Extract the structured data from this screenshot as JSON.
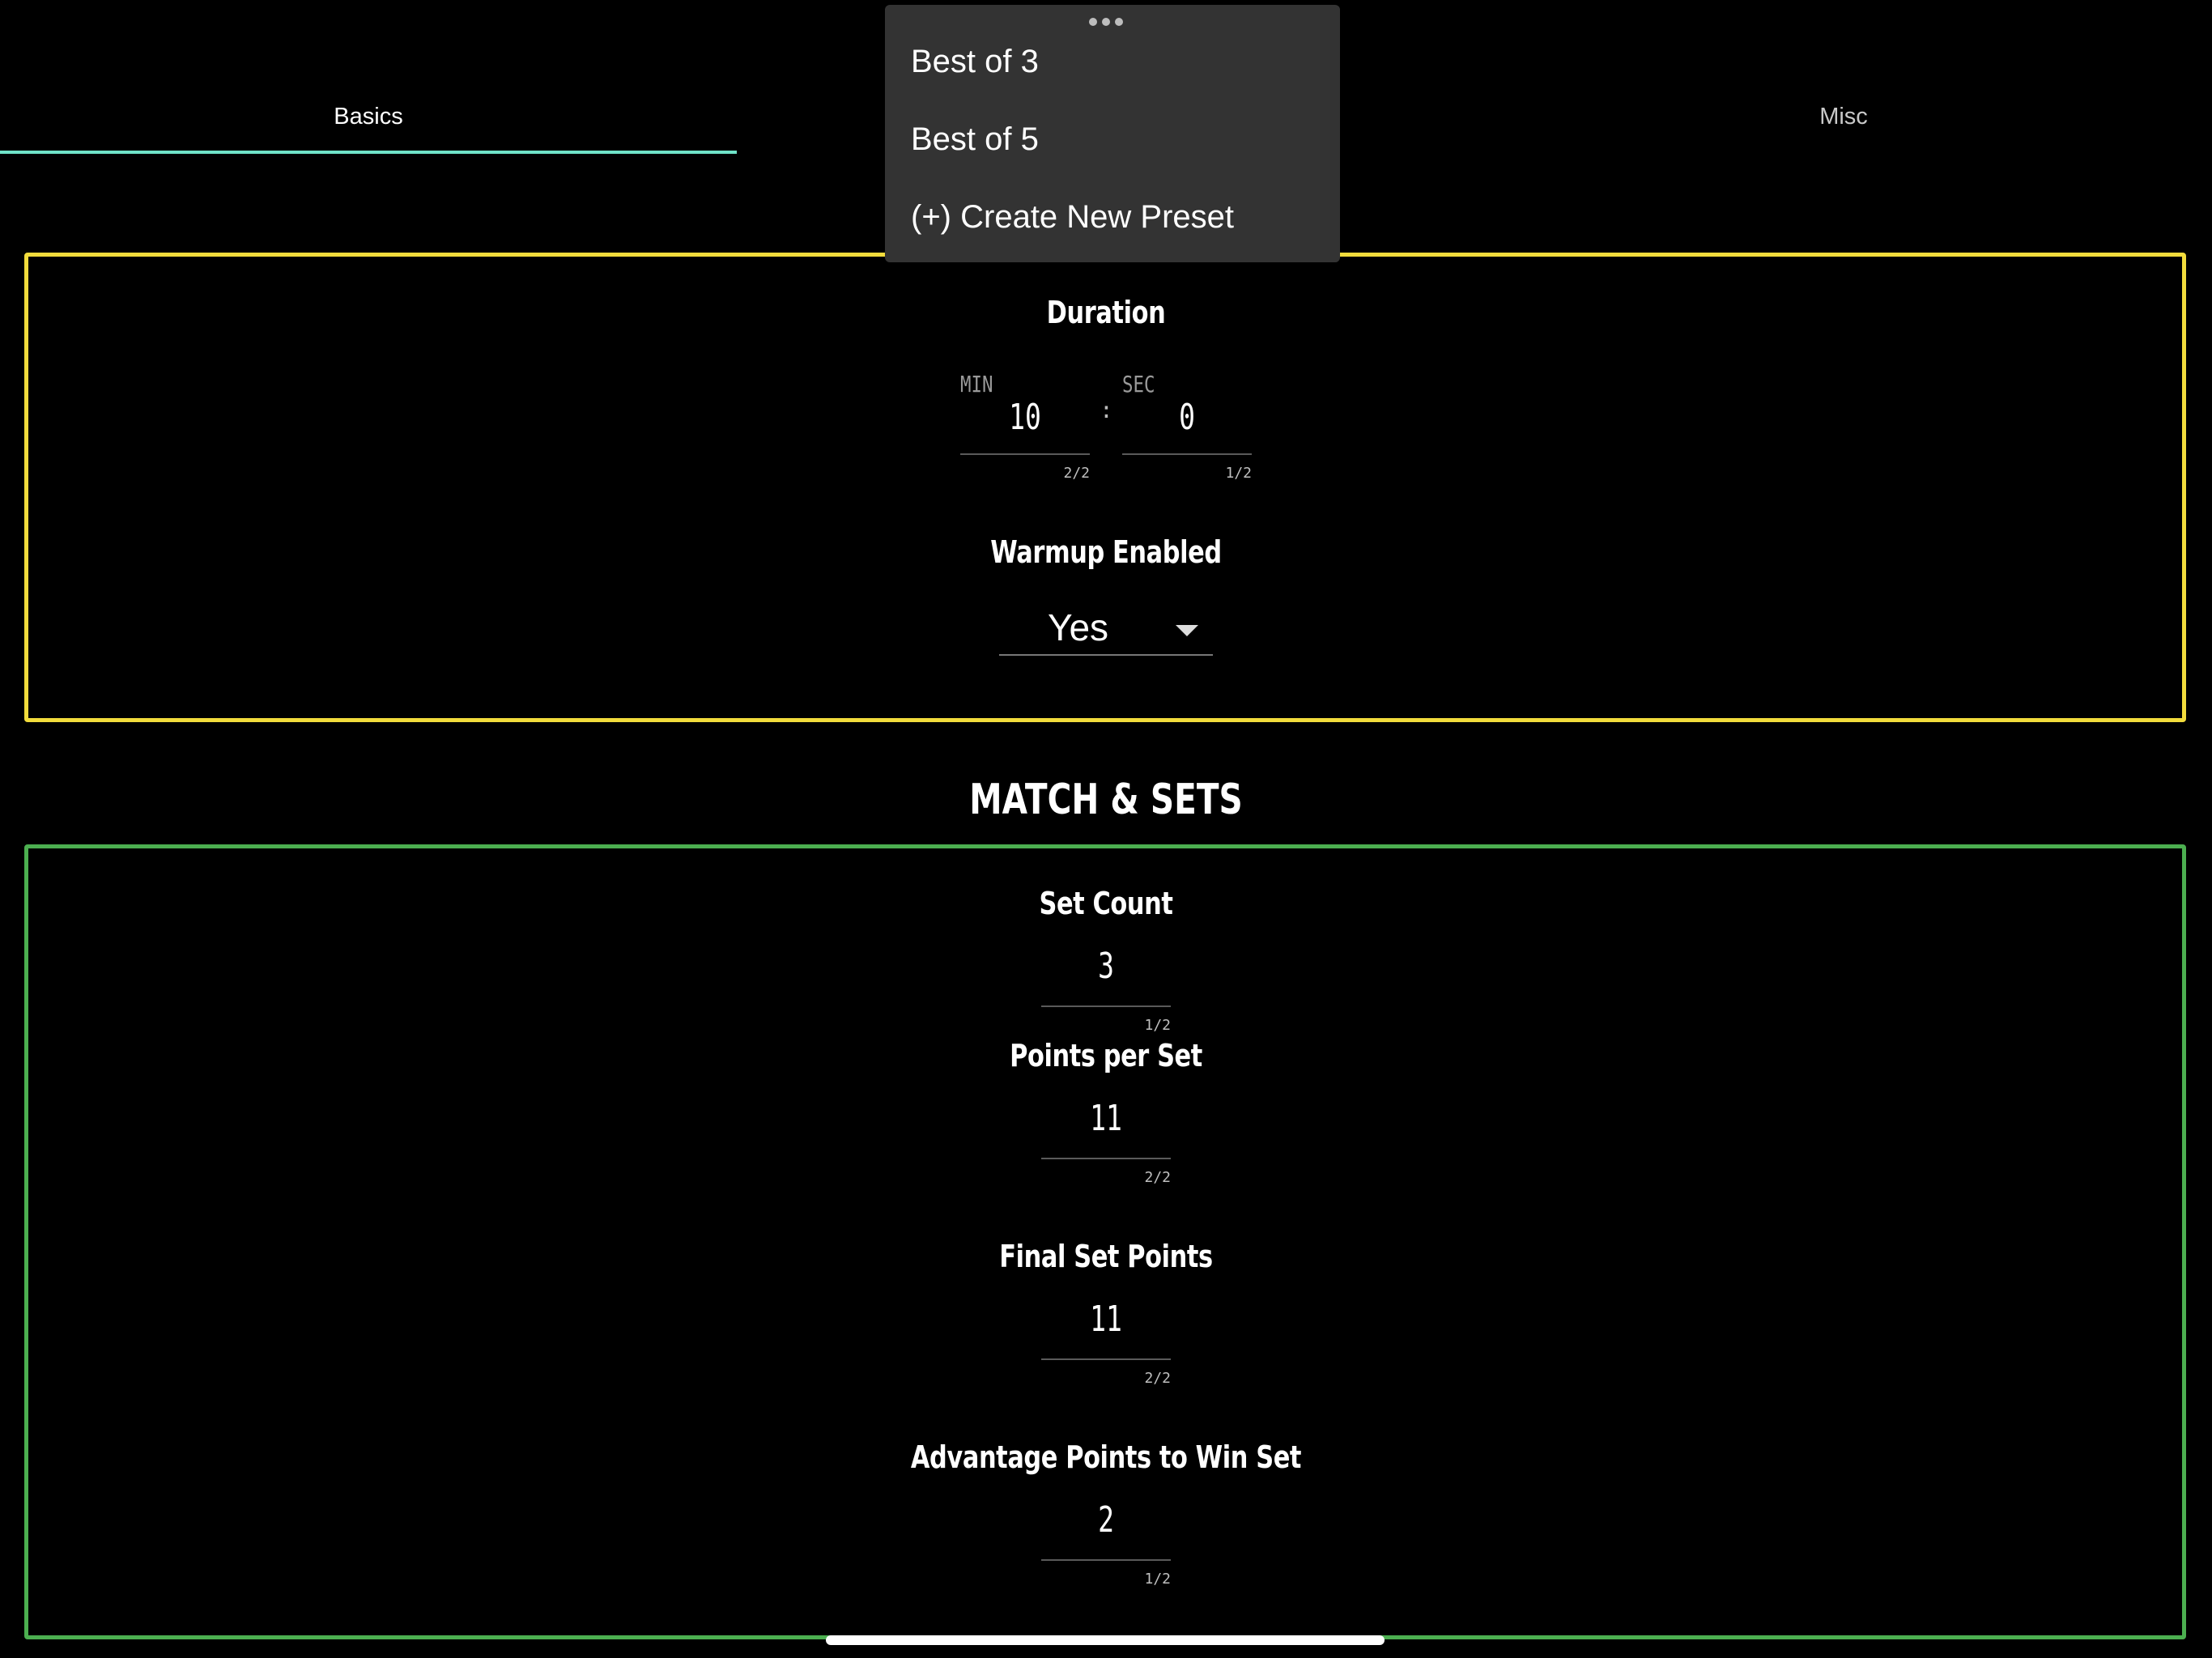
{
  "tabs": [
    {
      "label": "Basics",
      "active": true
    },
    {
      "label": "Misc",
      "active": false
    }
  ],
  "colors": {
    "accent": "#6fe3c8",
    "yellow_panel": "#f2dc3c",
    "green_panel": "#4caf50",
    "menu_bg": "#333333"
  },
  "menu": {
    "items": [
      "Best of 3",
      "Best of 5",
      "(+) Create New Preset"
    ]
  },
  "duration": {
    "title": "Duration",
    "min_label": "MIN",
    "sec_label": "SEC",
    "minutes": "10",
    "seconds": "0",
    "separator": ":",
    "min_counter": "2/2",
    "sec_counter": "1/2"
  },
  "warmup": {
    "title": "Warmup Enabled",
    "value": "Yes"
  },
  "match_sets": {
    "title": "MATCH & SETS",
    "set_count": {
      "title": "Set Count",
      "value": "3",
      "counter": "1/2"
    },
    "points_per_set": {
      "title": "Points per Set",
      "value": "11",
      "counter": "2/2"
    },
    "final_set_points": {
      "title": "Final Set Points",
      "value": "11",
      "counter": "2/2"
    },
    "advantage_points": {
      "title": "Advantage Points to Win Set",
      "value": "2",
      "counter": "1/2"
    }
  }
}
